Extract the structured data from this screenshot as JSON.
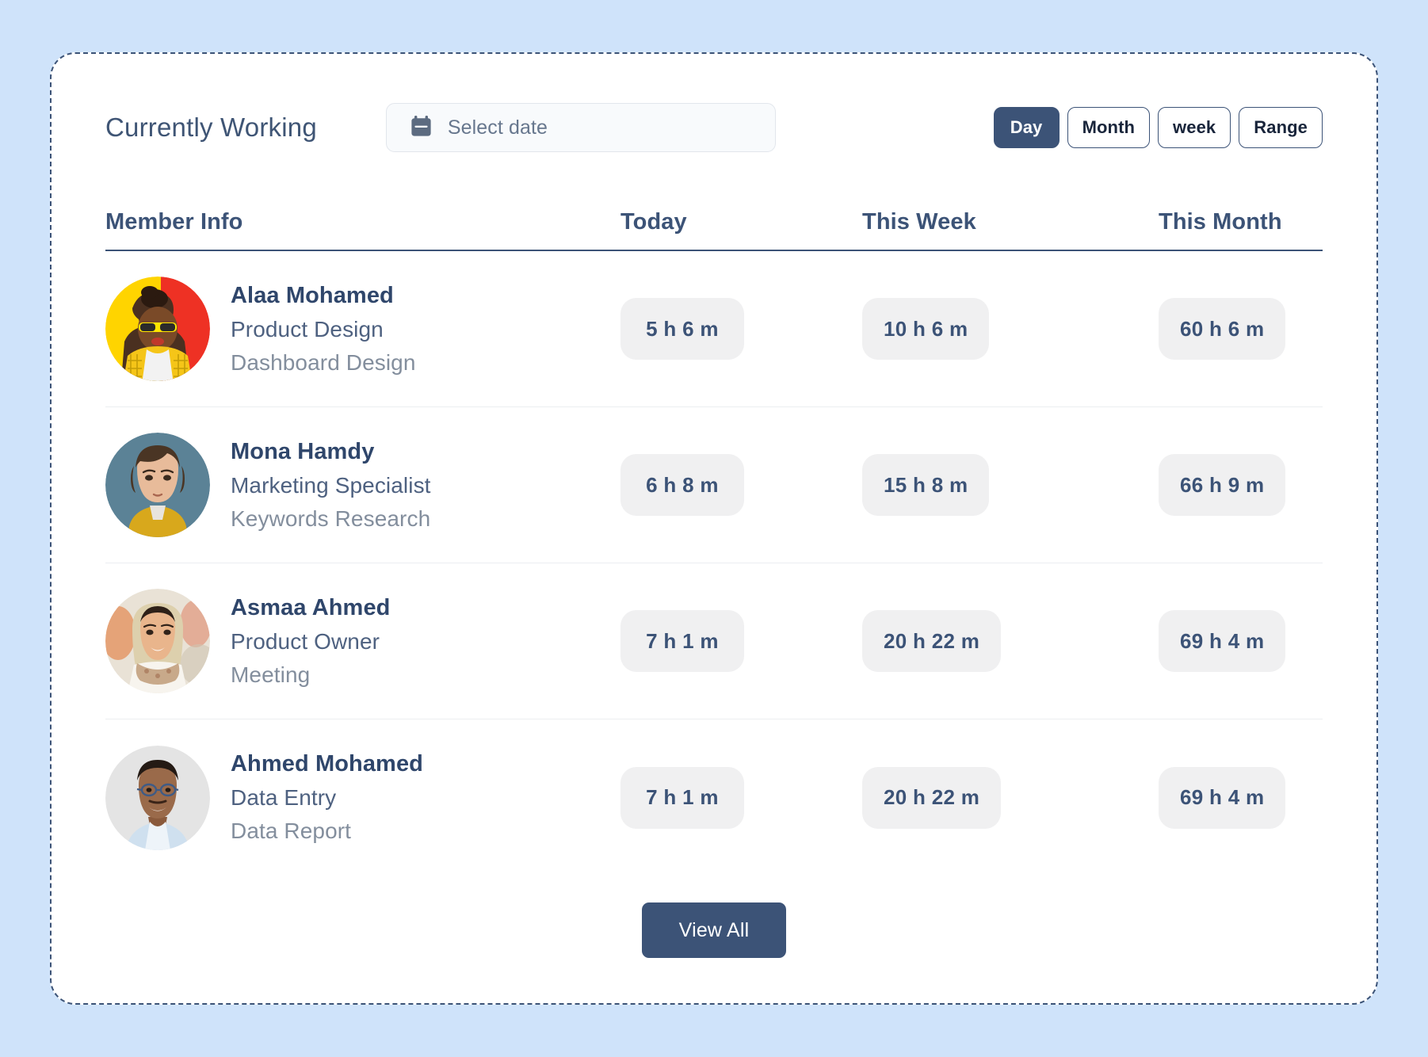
{
  "theme": {
    "page_background": "#cfe3fa",
    "card_background": "#ffffff",
    "accent_navy": "#3c5377",
    "pill_background": "#f0f0f1",
    "muted_text": "#838e9d"
  },
  "header": {
    "title": "Currently Working",
    "date_picker": {
      "icon": "calendar-icon",
      "placeholder": "Select date",
      "value": ""
    },
    "range_buttons": [
      {
        "label": "Day",
        "active": true
      },
      {
        "label": "Month",
        "active": false
      },
      {
        "label": "week",
        "active": false
      },
      {
        "label": "Range",
        "active": false
      }
    ]
  },
  "table": {
    "columns": [
      "Member Info",
      "Today",
      "This Week",
      "This Month"
    ],
    "rows": [
      {
        "name": "Alaa Mohamed",
        "role": "Product Design",
        "task": "Dashboard Design",
        "today": "5 h 6 m",
        "this_week": "10 h 6 m",
        "this_month": "60 h 6 m",
        "avatar": "avatar-alaa-mohamed"
      },
      {
        "name": "Mona Hamdy",
        "role": "Marketing Specialist",
        "task": "Keywords Research",
        "today": "6 h 8 m",
        "this_week": "15 h 8 m",
        "this_month": "66 h 9 m",
        "avatar": "avatar-mona-hamdy"
      },
      {
        "name": "Asmaa Ahmed",
        "role": "Product Owner",
        "task": "Meeting",
        "today": "7 h 1 m",
        "this_week": "20 h 22 m",
        "this_month": "69 h 4 m",
        "avatar": "avatar-asmaa-ahmed"
      },
      {
        "name": "Ahmed Mohamed",
        "role": "Data Entry",
        "task": "Data Report",
        "today": "7 h 1 m",
        "this_week": "20 h 22 m",
        "this_month": "69 h 4 m",
        "avatar": "avatar-ahmed-mohamed"
      }
    ]
  },
  "footer": {
    "view_all_label": "View All"
  }
}
